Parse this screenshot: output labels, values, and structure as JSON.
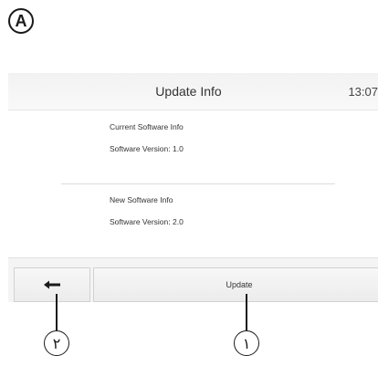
{
  "figure_label": "A",
  "header": {
    "title": "Update Info",
    "time": "13:07"
  },
  "current": {
    "heading": "Current Software Info",
    "version": "Software Version: 1.0"
  },
  "new": {
    "heading": "New Software Info",
    "version": "Software Version: 2.0"
  },
  "footer": {
    "update_label": "Update",
    "back_icon": "back-arrow-icon"
  },
  "callouts": {
    "back": "٢",
    "update": "١"
  }
}
